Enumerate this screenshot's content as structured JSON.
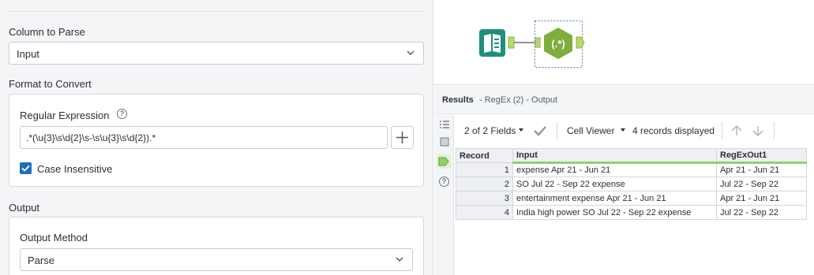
{
  "config": {
    "column_to_parse": {
      "title": "Column to Parse",
      "value": "Input"
    },
    "format_to_convert": {
      "title": "Format to Convert",
      "regex_label": "Regular Expression",
      "regex_value": ".*(\\u{3}\\s\\d{2}\\s-\\s\\u{3}\\s\\d{2}).*",
      "case_insensitive_label": "Case Insensitive",
      "case_insensitive_checked": true
    },
    "output": {
      "title": "Output",
      "method_label": "Output Method",
      "method_value": "Parse"
    }
  },
  "canvas": {
    "tool_label": "(.*)"
  },
  "results": {
    "title": "Results",
    "subtitle": "- RegEx (2) - Output",
    "fields": "2 of 2 Fields",
    "viewer": "Cell Viewer",
    "records_displayed": "4 records displayed",
    "columns": [
      "Record",
      "Input",
      "RegExOut1"
    ],
    "rows": [
      {
        "record": "1",
        "input": "expense Apr 21 - Jun 21",
        "out": "Apr 21 - Jun 21"
      },
      {
        "record": "2",
        "input": "SO Jul 22 - Sep 22 expense",
        "out": "Jul 22 - Sep 22"
      },
      {
        "record": "3",
        "input": "entertainment expense Apr 21 - Jun 21",
        "out": "Apr 21 - Jun 21"
      },
      {
        "record": "4",
        "input": "India high power SO Jul 22 - Sep 22 expense",
        "out": "Jul 22 - Sep 22"
      }
    ]
  },
  "colors": {
    "accent_blue": "#1e6fb8",
    "input_tool_teal": "#1e8f7d",
    "regex_tool_green": "#7fae3c",
    "connector_green": "#b5d96a"
  }
}
